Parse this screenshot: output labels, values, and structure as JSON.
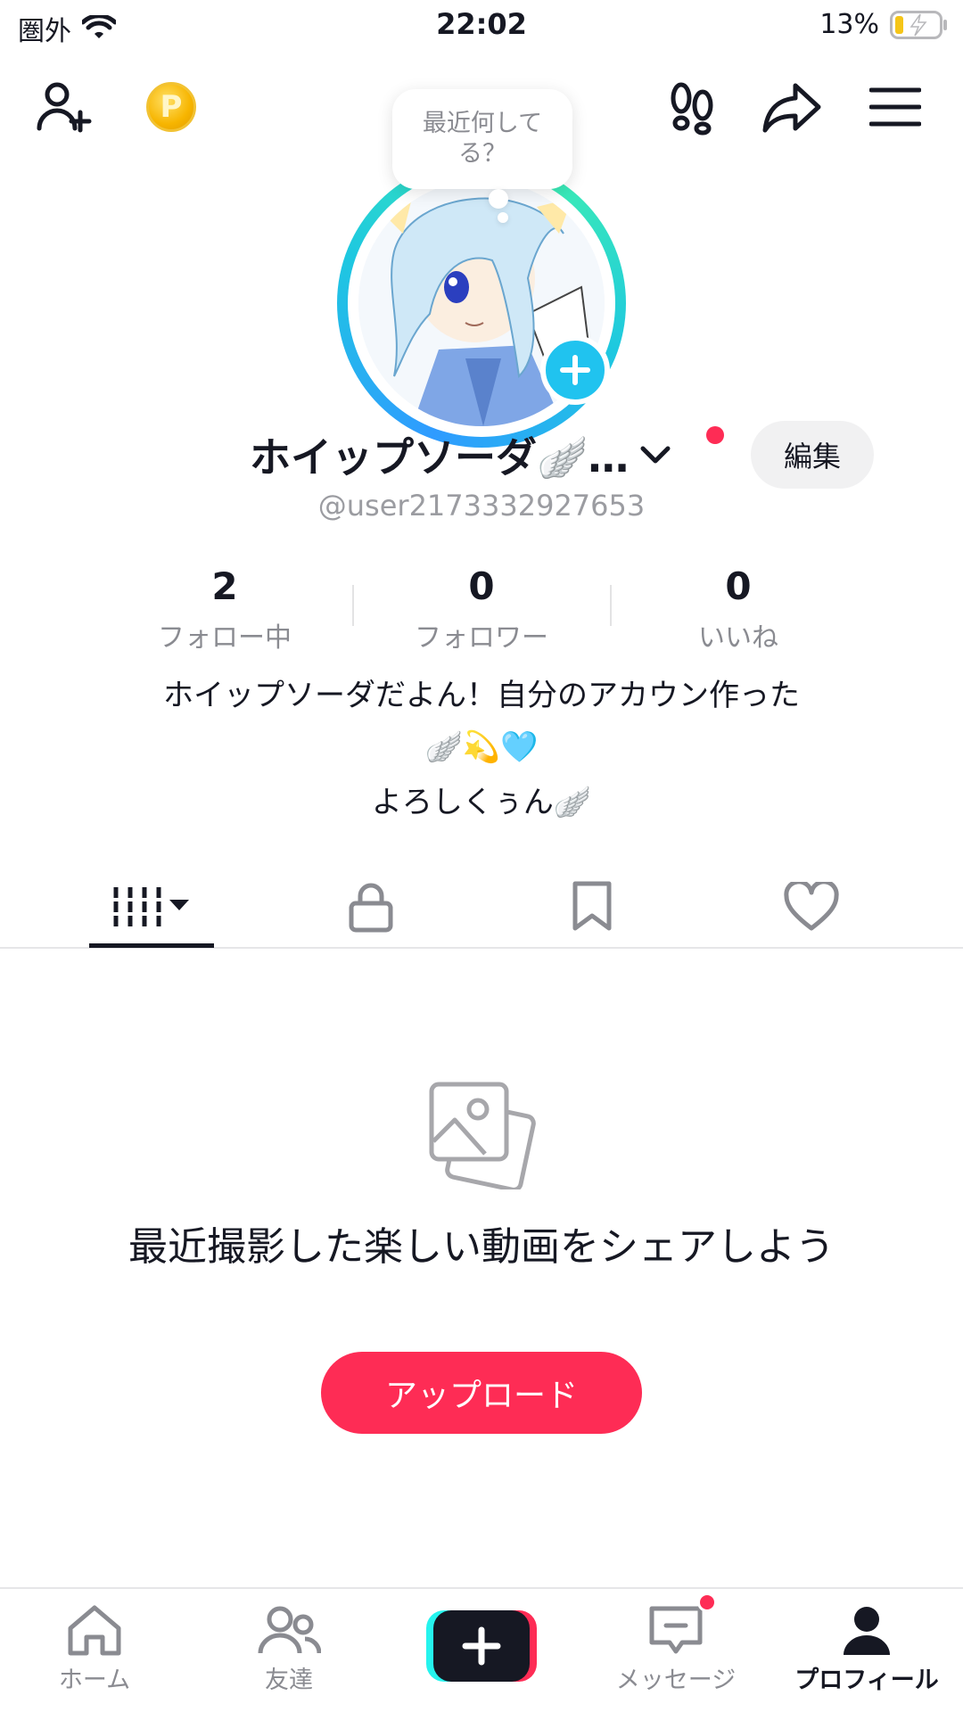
{
  "status_bar": {
    "carrier": "圏外",
    "time": "22:02",
    "battery": "13%"
  },
  "header": {
    "add_friend_icon": "person-plus-icon",
    "coin_label": "P",
    "footprints_icon": "footprints-icon",
    "share_icon": "share-arrow-icon",
    "menu_icon": "hamburger-menu-icon"
  },
  "profile": {
    "status_bubble": "最近何してる？",
    "display_name": "ホイップソーダ🪽…",
    "edit_label": "編集",
    "username": "@user2173332927653"
  },
  "stats": [
    {
      "value": "2",
      "label": "フォロー中"
    },
    {
      "value": "0",
      "label": "フォロワー"
    },
    {
      "value": "0",
      "label": "いいね"
    }
  ],
  "bio": {
    "line1": "ホイップソーダだよん！自分のアカウン作った",
    "line2": "🪽💫🩵",
    "line3": "よろしくぅん🪽"
  },
  "tabs": [
    {
      "name": "videos-grid-icon",
      "active": true
    },
    {
      "name": "lock-icon",
      "active": false
    },
    {
      "name": "bookmark-icon",
      "active": false
    },
    {
      "name": "heart-icon",
      "active": false
    }
  ],
  "empty_state": {
    "message": "最近撮影した楽しい動画をシェアしよう",
    "button": "アップロード"
  },
  "bottom_nav": {
    "home": "ホーム",
    "friends": "友達",
    "messages": "メッセージ",
    "profile": "プロフィール"
  },
  "colors": {
    "accent": "#fe2c55",
    "cyan": "#20c3ef",
    "text": "#161823",
    "muted": "#8a8b91"
  }
}
